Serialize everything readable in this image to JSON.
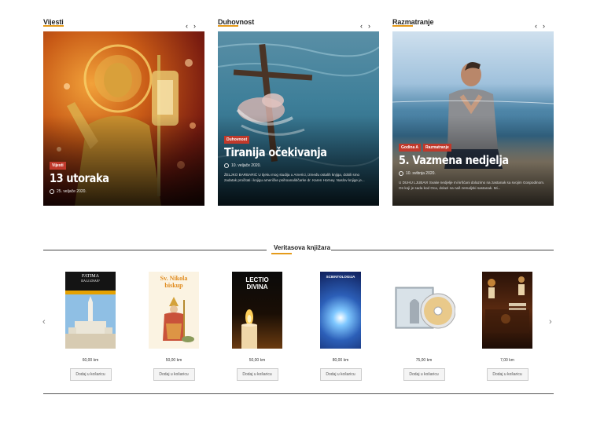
{
  "columns": [
    {
      "title": "Vijesti",
      "nav": {
        "prev": "‹",
        "next": "›"
      },
      "post": {
        "badges": [
          "Vijesti"
        ],
        "title": "13 utoraka",
        "date": "25. veljače 2020.",
        "excerpt": ""
      }
    },
    {
      "title": "Duhovnost",
      "nav": {
        "prev": "‹",
        "next": "›"
      },
      "post": {
        "badges": [
          "Duhovnost"
        ],
        "title": "Tiranija očekivanja",
        "date": "10. veljače 2020.",
        "excerpt": "ŽELJKO BARBARIĆ U tijeku mog studija u Americi, između ostalih knjiga, dobili smo zadatak pročitati i knjigu američke psihoanalitičarke dr. Karen Horney. Naslov knjige je..."
      }
    },
    {
      "title": "Razmatranje",
      "nav": {
        "prev": "‹",
        "next": "›"
      },
      "post": {
        "badges": [
          "Godina A",
          "Razmatranje"
        ],
        "title": "5. Vazmena nedjelja",
        "date": "10. svibnja 2020.",
        "excerpt": "U DUHU LJUBAVI Svake nedjelje mi kršćani dolazimo na zastanak sa svojim Gospodinom. On koji je sada kod Oca, dolazi na naš zemaljski sastanak. Mi..."
      }
    }
  ],
  "bookstore": {
    "title": "Veritasova knjižara",
    "prev_arrow": "‹",
    "next_arrow": "›",
    "products": [
      {
        "cover_title": "FATIMA",
        "cover_subtitle": "DA LI ZNAŠ?",
        "price": "60,00 km",
        "button": "Dodaj u košaricu"
      },
      {
        "cover_title": "Sv. Nikola",
        "cover_subtitle": "biskup",
        "price": "50,00 km",
        "button": "Dodaj u košaricu"
      },
      {
        "cover_title": "LECTIO",
        "cover_subtitle": "DIVINA",
        "price": "50,00 km",
        "button": "Dodaj u košaricu"
      },
      {
        "cover_title": "SCIENTOLOGIJA",
        "cover_subtitle": "",
        "price": "80,00 km",
        "button": "Dodaj u košaricu"
      },
      {
        "cover_title": "",
        "cover_subtitle": "",
        "price": "75,00 km",
        "button": "Dodaj u košaricu"
      },
      {
        "cover_title": "",
        "cover_subtitle": "",
        "price": "7,00 km",
        "button": "Dodaj u košaricu"
      }
    ]
  },
  "colors": {
    "accent": "#e59b1b",
    "badge": "#c0392b"
  }
}
